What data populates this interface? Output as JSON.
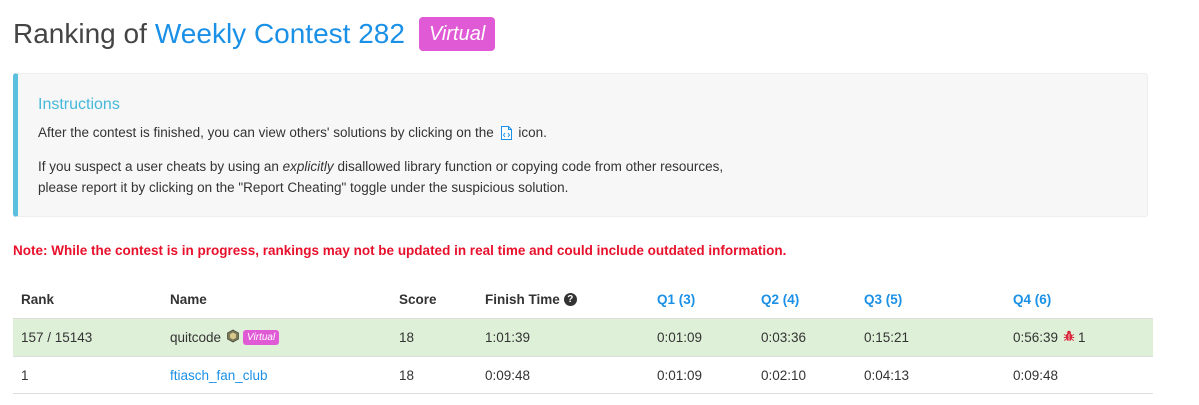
{
  "header": {
    "title_prefix": "Ranking of",
    "contest_name": "Weekly Contest 282",
    "virtual_badge": "Virtual"
  },
  "instructions": {
    "heading": "Instructions",
    "line1_before": "After the contest is finished, you can view others' solutions by clicking on the",
    "line1_after": "icon.",
    "line2_before": "If you suspect a user cheats by using an",
    "line2_emphasis": "explicitly",
    "line2_after": "disallowed library function or copying code from other resources,",
    "line3": "please report it by clicking on the \"Report Cheating\" toggle under the suspicious solution.",
    "icon": "solution-code-icon"
  },
  "note": "Note: While the contest is in progress, rankings may not be updated in real time and could include outdated information.",
  "table": {
    "columns": {
      "rank": "Rank",
      "name": "Name",
      "score": "Score",
      "finish_time": "Finish Time",
      "q1": "Q1 (3)",
      "q2": "Q2 (4)",
      "q3": "Q3 (5)",
      "q4": "Q4 (6)"
    },
    "rows": [
      {
        "rank": "157 / 15143",
        "name": "quitcode",
        "badge": "Virtual",
        "score": "18",
        "finish_time": "1:01:39",
        "q1": "0:01:09",
        "q2": "0:03:36",
        "q3": "0:15:21",
        "q4": "0:56:39",
        "q4_wrong": "1",
        "highlight_color": "#dff0d8"
      },
      {
        "rank": "1",
        "name": "ftiasch_fan_club",
        "score": "18",
        "finish_time": "0:09:48",
        "q1": "0:01:09",
        "q2": "0:02:10",
        "q3": "0:04:13",
        "q4": "0:09:48"
      }
    ]
  },
  "colors": {
    "link": "#1a90e6",
    "virtual_badge": "#e05ad6",
    "info_accent": "#5bc0de",
    "note_red": "#e8102b",
    "bug_red": "#d9263a"
  }
}
